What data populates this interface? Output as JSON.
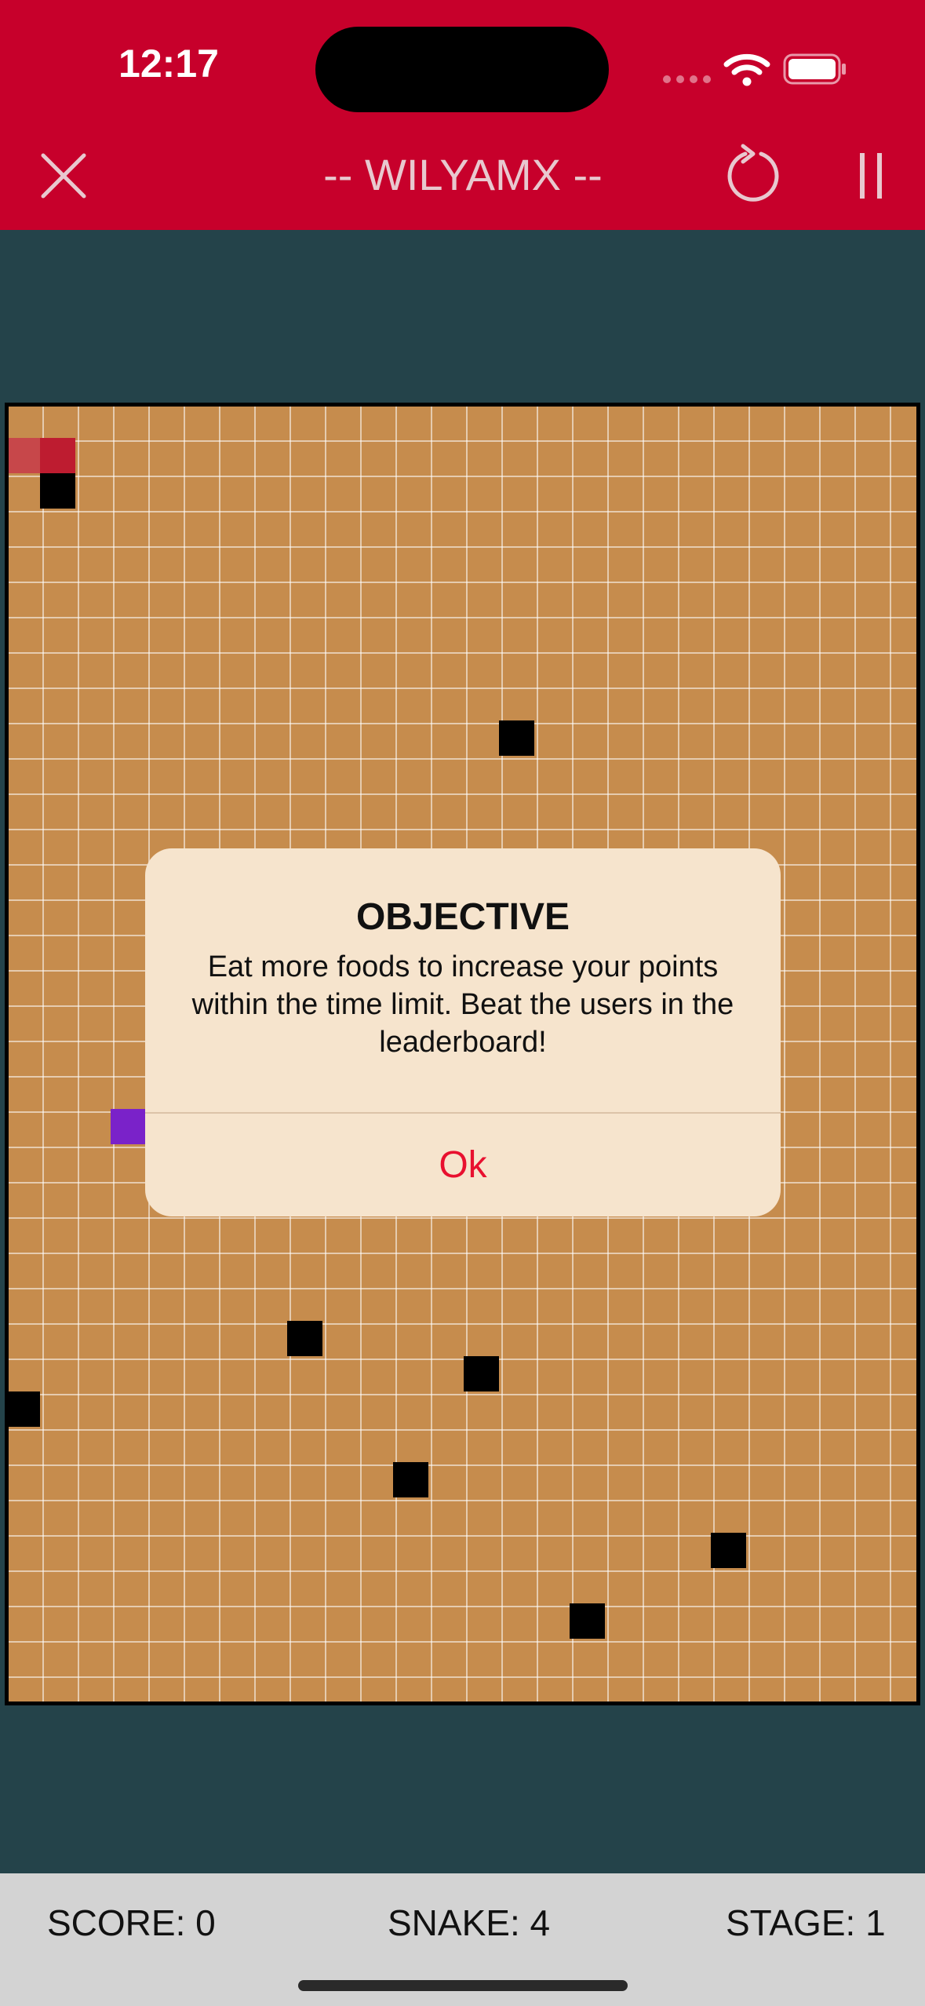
{
  "status_bar": {
    "time": "12:17"
  },
  "header": {
    "title": "-- WILYAMX --",
    "close_icon": "close-icon",
    "restart_icon": "restart-icon",
    "pause_icon": "pause-icon"
  },
  "game": {
    "colors": {
      "header": "#c7002b",
      "background": "#24434a",
      "board": "#c68c4d",
      "snake_head": "#be1c30",
      "snake_tail": "#c7474a",
      "food": "#7a22c9",
      "obstacle": "#000000"
    }
  },
  "modal": {
    "title": "OBJECTIVE",
    "message": "Eat more foods to increase your points within the time limit. Beat the users in the leaderboard!",
    "ok_label": "Ok"
  },
  "footer": {
    "score": "SCORE: 0",
    "snake": "SNAKE: 4",
    "stage": "STAGE: 1"
  }
}
